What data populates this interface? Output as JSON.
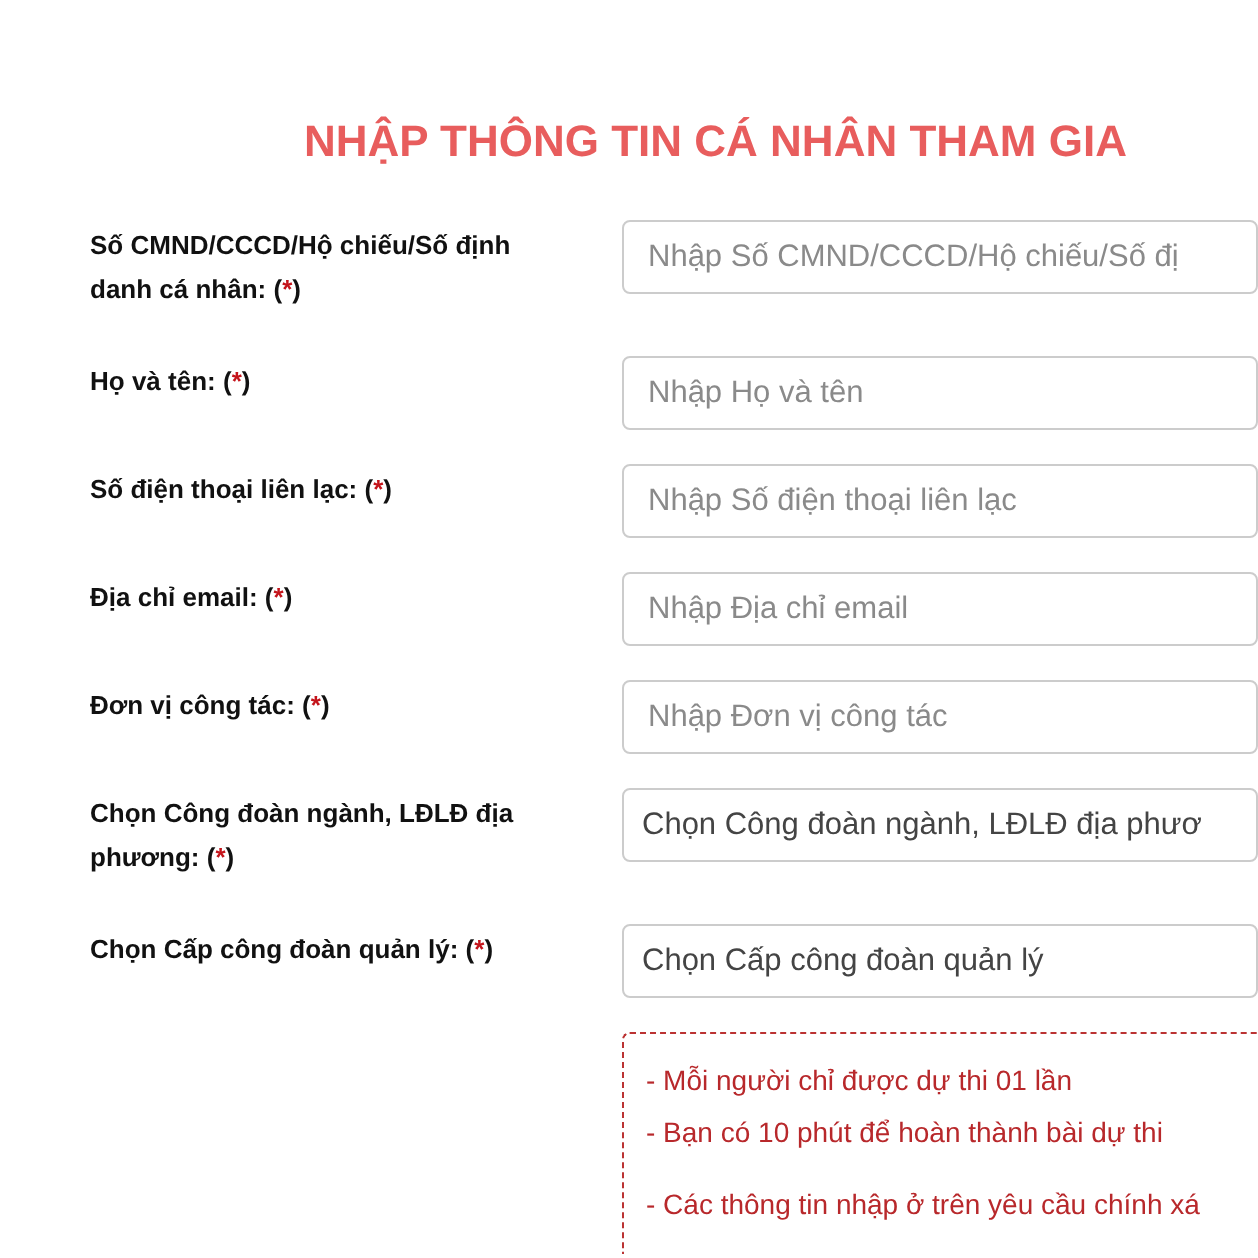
{
  "title": "NHẬP THÔNG TIN CÁ NHÂN THAM GIA",
  "fields": [
    {
      "label": "Số CMND/CCCD/Hộ chiếu/Số định danh cá nhân:",
      "required_mark": "(*)",
      "kind": "input",
      "placeholder": "Nhập Số CMND/CCCD/Hộ chiếu/Số đị"
    },
    {
      "label": "Họ và tên:",
      "required_mark": "(*)",
      "kind": "input",
      "placeholder": "Nhập Họ và tên"
    },
    {
      "label": "Số điện thoại liên lạc:",
      "required_mark": "(*)",
      "kind": "input",
      "placeholder": "Nhập Số điện thoại liên lạc"
    },
    {
      "label": "Địa chỉ email:",
      "required_mark": "(*)",
      "kind": "input",
      "placeholder": "Nhập Địa chỉ email"
    },
    {
      "label": "Đơn vị công tác:",
      "required_mark": "(*)",
      "kind": "input",
      "placeholder": "Nhập Đơn vị công tác"
    },
    {
      "label": "Chọn Công đoàn ngành, LĐLĐ địa phương:",
      "required_mark": "(*)",
      "kind": "select",
      "value": "Chọn Công đoàn ngành, LĐLĐ địa phươ"
    },
    {
      "label": "Chọn Cấp công đoàn quản lý:",
      "required_mark": "(*)",
      "kind": "select",
      "value": "Chọn Cấp công đoàn quản lý"
    }
  ],
  "notice": {
    "lines": [
      "- Mỗi người chỉ được dự thi 01 lần",
      "- Bạn có 10 phút để hoàn thành bài dự thi",
      "- Các thông tin nhập ở trên yêu cầu chính xá"
    ]
  }
}
